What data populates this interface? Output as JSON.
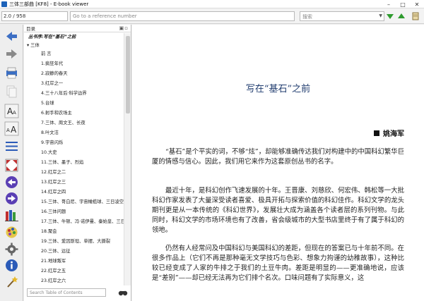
{
  "window": {
    "title": "三体三部曲 [KF8] - E-book viewer"
  },
  "toolbar": {
    "page_field": "2.0 / 958",
    "reference_placeholder": "Go to a reference number",
    "search_placeholder": "搜索"
  },
  "toc": {
    "header": "目录",
    "book_title": "丛书序:写在“基石”之前",
    "part": "三体",
    "items": [
      "前 言",
      "1.疯狂年代",
      "2.寂静的春天",
      "3.红岸之一",
      "4.三十八年后·科学边界",
      "5.台球",
      "6.射手和农场主",
      "7.三体、周文王、长夜",
      "8.叶文洁",
      "9.宇宙闪烁",
      "10.大史",
      "11.三体、墨子、烈焰",
      "12.红岸之二",
      "13.红岸之三",
      "14.红岸之四",
      "15.三体、哥白尼、宇宙橄榄球、三日凌空",
      "16.三体问题",
      "17.三体、牛顿、冯·诺伊曼、秦始皇、三日连珠",
      "18.聚会",
      "19.三体、爱因斯坦、单摆、大撕裂",
      "20.三体、远征",
      "21.地球叛军",
      "22.红岸之五",
      "23.红岸之六"
    ],
    "search_placeholder": "Search Table of Contents"
  },
  "reader": {
    "title": "写在“基石”之前",
    "author": "姚海军",
    "paragraphs": [
      "“基石”是个平实的词，不够“炫”，却能够准确传达我们对构建中的中国科幻繁华巨厦的情感与信心。因此，我们用它来作为这套原创丛书的名字。",
      "最近十年，是科幻创作飞速发展的十年。王晋康、刘慈欣、何宏伟、韩松等一大批科幻作家发表了大量深受读者喜爱、极具开拓与探索价值的科幻佳作。科幻文学的龙头期刊更是从一本传统的《科幻世界》，发展壮大成为涵盖各个读者层的系列刊物。与此同时，科幻文学的市场环境也有了改善，省会级城市的大型书店里终于有了属于科幻的领地。",
      "仍然有人经常问及中国科幻与美国科幻的差距，但现在的答案已与十年前不同。在很多作品上（它们不再是那种毫无文学技巧与色彩、想象力拘谨的幼稚故事），这种比较已经变成了人家的牛排之于我们的土豆牛肉。差距是明显的——更准确地说，应该是“差别”——却已经无法再为它们排个名次。口味问题有了实际意义，这"
    ]
  },
  "colors": {
    "accent_blue": "#1c62b9",
    "title_blue": "#1f3b6e",
    "arrow_green": "#2e9b2e"
  }
}
